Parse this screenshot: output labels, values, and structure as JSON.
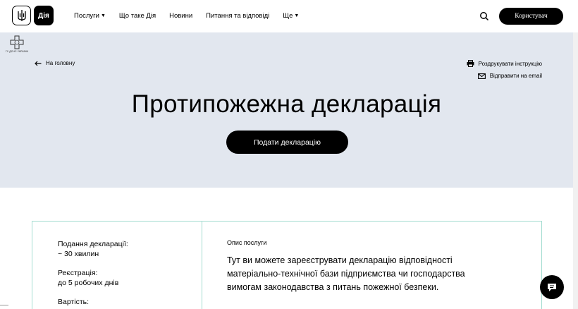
{
  "header": {
    "logo_trident": "trident-icon",
    "logo_diia": "Дія",
    "nav": [
      {
        "label": "Послуги",
        "has_caret": true
      },
      {
        "label": "Що таке Дія",
        "has_caret": false
      },
      {
        "label": "Новини",
        "has_caret": false
      },
      {
        "label": "Питання та відповіді",
        "has_caret": false
      },
      {
        "label": "Ще",
        "has_caret": true
      }
    ],
    "user_button": "Користувач"
  },
  "hero": {
    "emblem_text": "ГУ ДСНС УКРАЇНИ",
    "back_link": "На головну",
    "print_link": "Роздрукувати інструкцію",
    "email_link": "Відправити на email",
    "title": "Протипожежна декларація",
    "submit_button": "Подати декларацію"
  },
  "card": {
    "items": [
      {
        "label": "Подання декларації:",
        "value": "~ 30 хвилин"
      },
      {
        "label": "Реєстрація:",
        "value": "до 5 робочих днів"
      },
      {
        "label": "Вартість:",
        "value": ""
      }
    ],
    "description_label": "Опис послуги",
    "description": "Тут ви можете зареєструвати декларацію відповідності матеріально-технічної бази підприємства чи господарства вимогам законодавства з питань пожежної безпеки."
  },
  "colors": {
    "hero_bg": "#e2e7ef",
    "card_border": "#a3dcd0",
    "button_bg": "#000000"
  }
}
